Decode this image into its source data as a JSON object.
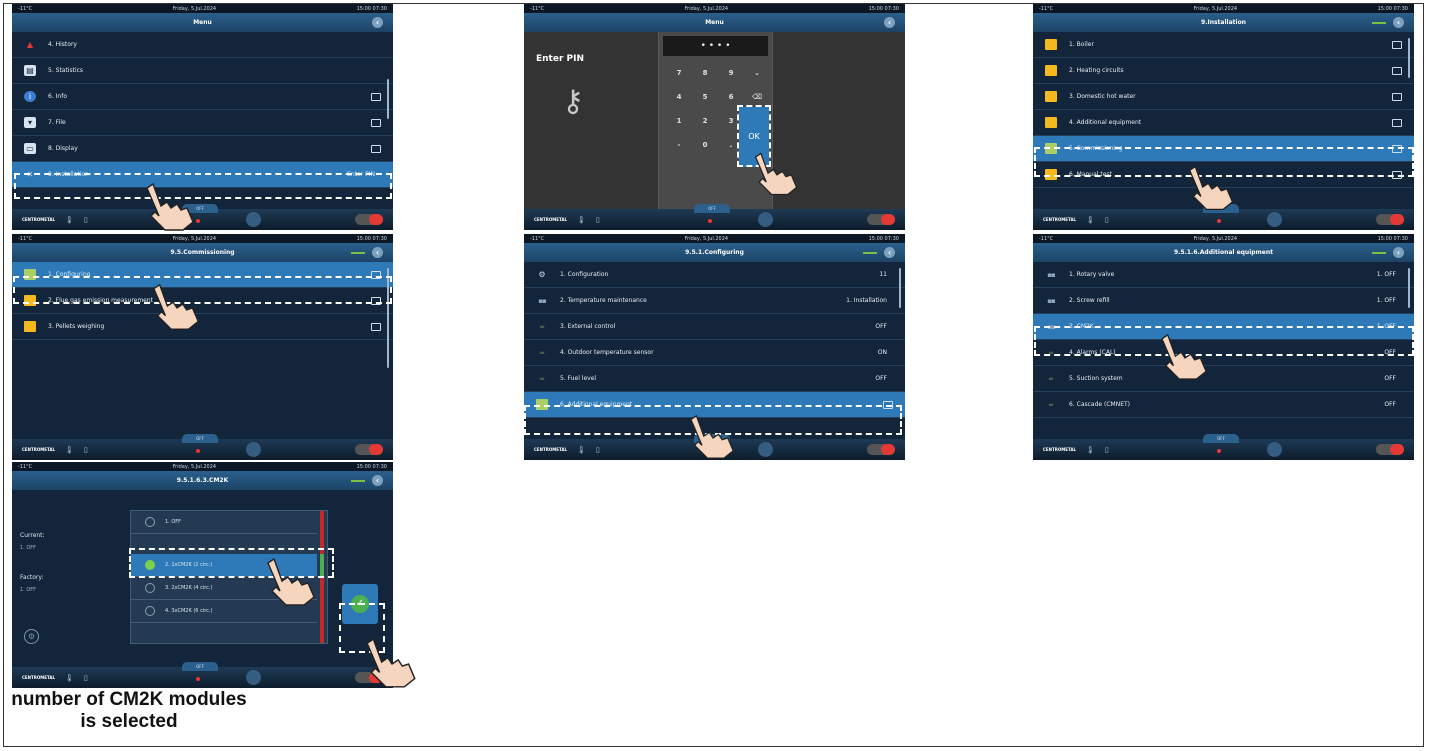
{
  "status": {
    "temp": "-11°C",
    "date": "Friday, 5.Jul.2024",
    "time": "15:00 07:30"
  },
  "panel1": {
    "title": "Menu",
    "items": [
      {
        "label": "4. History",
        "icon": "warning-icon"
      },
      {
        "label": "5. Statistics",
        "icon": "chart-icon"
      },
      {
        "label": "6. Info",
        "icon": "info-icon"
      },
      {
        "label": "7. File",
        "icon": "file-icon"
      },
      {
        "label": "8. Display",
        "icon": "display-icon"
      },
      {
        "label": "9. Installation",
        "value": "Enter PIN",
        "icon": "tools-icon"
      }
    ]
  },
  "panel2": {
    "title": "Menu",
    "pin_label": "Enter PIN",
    "pin_value": "• • • •",
    "keys": [
      "7",
      "8",
      "9",
      "4",
      "5",
      "6",
      "1",
      "2",
      "3",
      "-",
      "0",
      "."
    ],
    "ok": "OK"
  },
  "panel3": {
    "title": "9.Installation",
    "items": [
      "1. Boiler",
      "2. Heating circuits",
      "3. Domestic hot water",
      "4. Additional equipment",
      "5. Commissioning",
      "6. Manual test"
    ]
  },
  "panel4": {
    "title": "9.5.Commissioning",
    "items": [
      "1. Configuring",
      "2. Flue gas emission measurement",
      "3. Pellets weighing"
    ]
  },
  "panel5": {
    "title": "9.5.1.Configuring",
    "items": [
      {
        "label": "1. Configuration",
        "value": "11"
      },
      {
        "label": "2. Temperature maintenance",
        "value": "1. Installation"
      },
      {
        "label": "3. External control",
        "value": "OFF"
      },
      {
        "label": "4. Outdoor temperature sensor",
        "value": "ON"
      },
      {
        "label": "5. Fuel level",
        "value": "OFF"
      },
      {
        "label": "6. Additional equipment",
        "value": ""
      }
    ]
  },
  "panel6": {
    "title": "9.5.1.6.Additional equipment",
    "items": [
      {
        "label": "1. Rotary valve",
        "value": "1. OFF"
      },
      {
        "label": "2. Screw refill",
        "value": "1. OFF"
      },
      {
        "label": "3. CM2K",
        "value": "1. OFF"
      },
      {
        "label": "4. Alarms (CAL)",
        "value": "OFF"
      },
      {
        "label": "5. Suction system",
        "value": "OFF"
      },
      {
        "label": "6. Cascade (CMNET)",
        "value": "OFF"
      }
    ]
  },
  "panel7": {
    "title": "9.5.1.6.3.CM2K",
    "current_label": "Current:",
    "current_value": "1. OFF",
    "factory_label": "Factory:",
    "factory_value": "1. OFF",
    "options": [
      "1. OFF",
      "2. 1xCM2K (2 circ.)",
      "3. 2xCM2K (4 circ.)",
      "4. 3xCM2K (6 circ.)"
    ]
  },
  "bottom": {
    "off_label": "OFF",
    "logo": "CENTROMETAL"
  },
  "caption": "number of CM2K modules is selected"
}
